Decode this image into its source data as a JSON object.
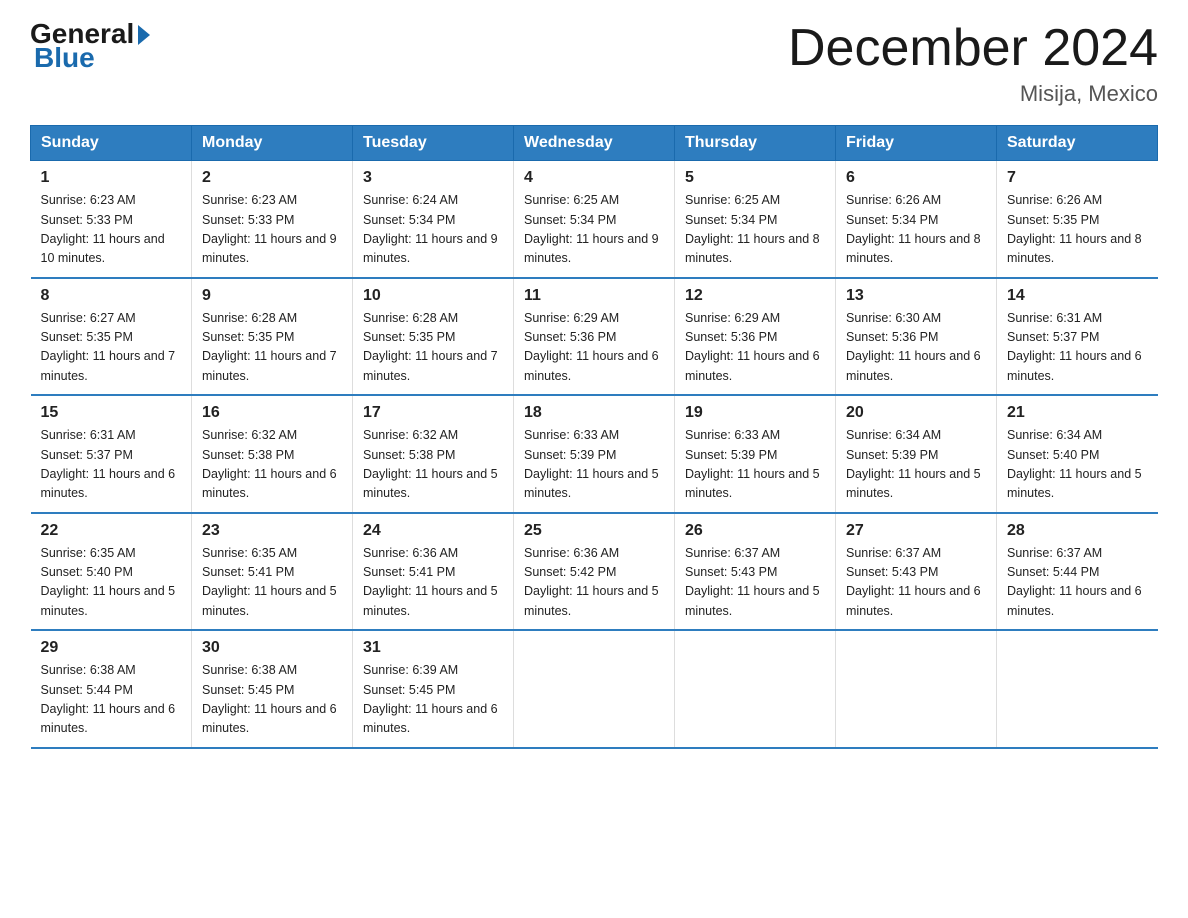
{
  "logo": {
    "general": "General",
    "blue": "Blue"
  },
  "title": "December 2024",
  "subtitle": "Misija, Mexico",
  "days_of_week": [
    "Sunday",
    "Monday",
    "Tuesday",
    "Wednesday",
    "Thursday",
    "Friday",
    "Saturday"
  ],
  "weeks": [
    [
      {
        "day": "1",
        "sunrise": "6:23 AM",
        "sunset": "5:33 PM",
        "daylight": "11 hours and 10 minutes."
      },
      {
        "day": "2",
        "sunrise": "6:23 AM",
        "sunset": "5:33 PM",
        "daylight": "11 hours and 9 minutes."
      },
      {
        "day": "3",
        "sunrise": "6:24 AM",
        "sunset": "5:34 PM",
        "daylight": "11 hours and 9 minutes."
      },
      {
        "day": "4",
        "sunrise": "6:25 AM",
        "sunset": "5:34 PM",
        "daylight": "11 hours and 9 minutes."
      },
      {
        "day": "5",
        "sunrise": "6:25 AM",
        "sunset": "5:34 PM",
        "daylight": "11 hours and 8 minutes."
      },
      {
        "day": "6",
        "sunrise": "6:26 AM",
        "sunset": "5:34 PM",
        "daylight": "11 hours and 8 minutes."
      },
      {
        "day": "7",
        "sunrise": "6:26 AM",
        "sunset": "5:35 PM",
        "daylight": "11 hours and 8 minutes."
      }
    ],
    [
      {
        "day": "8",
        "sunrise": "6:27 AM",
        "sunset": "5:35 PM",
        "daylight": "11 hours and 7 minutes."
      },
      {
        "day": "9",
        "sunrise": "6:28 AM",
        "sunset": "5:35 PM",
        "daylight": "11 hours and 7 minutes."
      },
      {
        "day": "10",
        "sunrise": "6:28 AM",
        "sunset": "5:35 PM",
        "daylight": "11 hours and 7 minutes."
      },
      {
        "day": "11",
        "sunrise": "6:29 AM",
        "sunset": "5:36 PM",
        "daylight": "11 hours and 6 minutes."
      },
      {
        "day": "12",
        "sunrise": "6:29 AM",
        "sunset": "5:36 PM",
        "daylight": "11 hours and 6 minutes."
      },
      {
        "day": "13",
        "sunrise": "6:30 AM",
        "sunset": "5:36 PM",
        "daylight": "11 hours and 6 minutes."
      },
      {
        "day": "14",
        "sunrise": "6:31 AM",
        "sunset": "5:37 PM",
        "daylight": "11 hours and 6 minutes."
      }
    ],
    [
      {
        "day": "15",
        "sunrise": "6:31 AM",
        "sunset": "5:37 PM",
        "daylight": "11 hours and 6 minutes."
      },
      {
        "day": "16",
        "sunrise": "6:32 AM",
        "sunset": "5:38 PM",
        "daylight": "11 hours and 6 minutes."
      },
      {
        "day": "17",
        "sunrise": "6:32 AM",
        "sunset": "5:38 PM",
        "daylight": "11 hours and 5 minutes."
      },
      {
        "day": "18",
        "sunrise": "6:33 AM",
        "sunset": "5:39 PM",
        "daylight": "11 hours and 5 minutes."
      },
      {
        "day": "19",
        "sunrise": "6:33 AM",
        "sunset": "5:39 PM",
        "daylight": "11 hours and 5 minutes."
      },
      {
        "day": "20",
        "sunrise": "6:34 AM",
        "sunset": "5:39 PM",
        "daylight": "11 hours and 5 minutes."
      },
      {
        "day": "21",
        "sunrise": "6:34 AM",
        "sunset": "5:40 PM",
        "daylight": "11 hours and 5 minutes."
      }
    ],
    [
      {
        "day": "22",
        "sunrise": "6:35 AM",
        "sunset": "5:40 PM",
        "daylight": "11 hours and 5 minutes."
      },
      {
        "day": "23",
        "sunrise": "6:35 AM",
        "sunset": "5:41 PM",
        "daylight": "11 hours and 5 minutes."
      },
      {
        "day": "24",
        "sunrise": "6:36 AM",
        "sunset": "5:41 PM",
        "daylight": "11 hours and 5 minutes."
      },
      {
        "day": "25",
        "sunrise": "6:36 AM",
        "sunset": "5:42 PM",
        "daylight": "11 hours and 5 minutes."
      },
      {
        "day": "26",
        "sunrise": "6:37 AM",
        "sunset": "5:43 PM",
        "daylight": "11 hours and 5 minutes."
      },
      {
        "day": "27",
        "sunrise": "6:37 AM",
        "sunset": "5:43 PM",
        "daylight": "11 hours and 6 minutes."
      },
      {
        "day": "28",
        "sunrise": "6:37 AM",
        "sunset": "5:44 PM",
        "daylight": "11 hours and 6 minutes."
      }
    ],
    [
      {
        "day": "29",
        "sunrise": "6:38 AM",
        "sunset": "5:44 PM",
        "daylight": "11 hours and 6 minutes."
      },
      {
        "day": "30",
        "sunrise": "6:38 AM",
        "sunset": "5:45 PM",
        "daylight": "11 hours and 6 minutes."
      },
      {
        "day": "31",
        "sunrise": "6:39 AM",
        "sunset": "5:45 PM",
        "daylight": "11 hours and 6 minutes."
      },
      null,
      null,
      null,
      null
    ]
  ],
  "labels": {
    "sunrise_prefix": "Sunrise: ",
    "sunset_prefix": "Sunset: ",
    "daylight_prefix": "Daylight: "
  }
}
